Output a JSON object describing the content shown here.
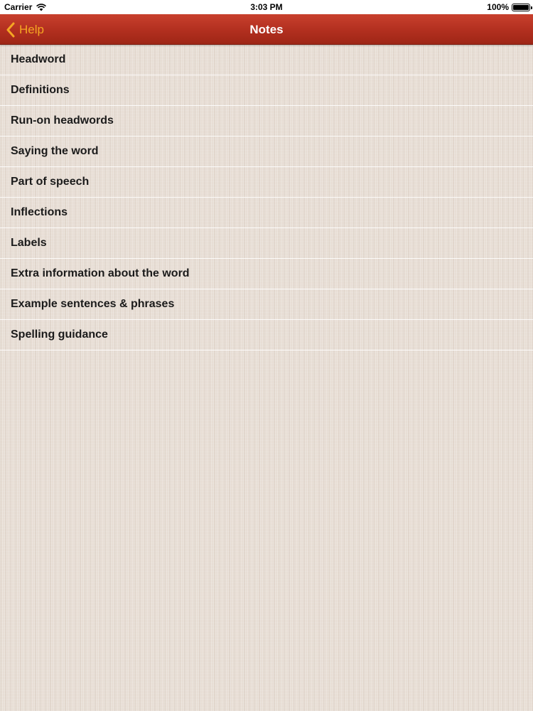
{
  "status_bar": {
    "carrier": "Carrier",
    "time": "3:03 PM",
    "battery": "100%"
  },
  "nav": {
    "back_label": "Help",
    "title": "Notes",
    "colors": {
      "bar": "#b22f1f",
      "back": "#f5a623",
      "title": "#ffffff"
    }
  },
  "list": {
    "items": [
      {
        "label": "Headword"
      },
      {
        "label": "Definitions"
      },
      {
        "label": "Run-on headwords"
      },
      {
        "label": "Saying the word"
      },
      {
        "label": "Part of speech"
      },
      {
        "label": "Inflections"
      },
      {
        "label": "Labels"
      },
      {
        "label": "Extra information about the word"
      },
      {
        "label": "Example sentences & phrases"
      },
      {
        "label": "Spelling guidance"
      }
    ]
  }
}
